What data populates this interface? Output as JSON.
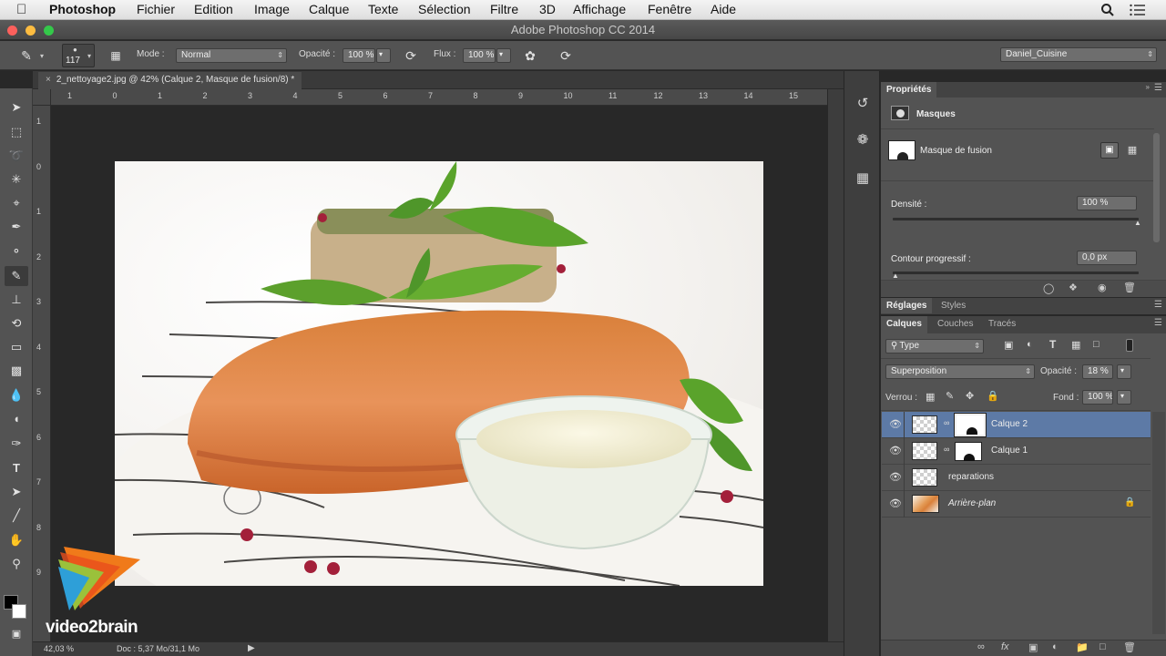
{
  "menubar": {
    "app": "Photoshop",
    "items": [
      "Fichier",
      "Edition",
      "Image",
      "Calque",
      "Texte",
      "Sélection",
      "Filtre",
      "3D",
      "Affichage",
      "Fenêtre",
      "Aide"
    ]
  },
  "window": {
    "title": "Adobe Photoshop CC 2014"
  },
  "options": {
    "brush_size": "117",
    "mode_label": "Mode :",
    "mode_value": "Normal",
    "opacity_label": "Opacité :",
    "opacity_value": "100 %",
    "flux_label": "Flux :",
    "flux_value": "100 %",
    "workspace": "Daniel_Cuisine"
  },
  "document": {
    "tab_title": "2_nettoyage2.jpg @ 42% (Calque 2, Masque de fusion/8) *",
    "ruler_h": [
      "1",
      "0",
      "1",
      "2",
      "3",
      "4",
      "5",
      "6",
      "7",
      "8",
      "9",
      "10",
      "11",
      "12",
      "13",
      "14",
      "15"
    ],
    "ruler_v": [
      "1",
      "0",
      "1",
      "2",
      "3",
      "4",
      "5",
      "6",
      "7",
      "8",
      "9"
    ]
  },
  "status": {
    "zoom": "42,03 %",
    "doc": "Doc : 5,37 Mo/31,1 Mo"
  },
  "properties": {
    "tab": "Propriétés",
    "section": "Masques",
    "mask_name": "Masque de fusion",
    "density_label": "Densité :",
    "density_value": "100 %",
    "density_level": 1.0,
    "feather_label": "Contour progressif :",
    "feather_value": "0,0 px",
    "feather_level": 0.0
  },
  "adjust_tabs": [
    "Réglages",
    "Styles"
  ],
  "layers_panel": {
    "tabs": [
      "Calques",
      "Couches",
      "Tracés"
    ],
    "filter": "Type",
    "blend_mode": "Superposition",
    "opacity_label": "Opacité :",
    "opacity_value": "18 %",
    "lock_label": "Verrou :",
    "fill_label": "Fond :",
    "fill_value": "100 %",
    "layers": [
      {
        "name": "Calque 2",
        "selected": true
      },
      {
        "name": "Calque 1",
        "selected": false
      },
      {
        "name": "reparations",
        "selected": false
      },
      {
        "name": "Arrière-plan",
        "selected": false
      }
    ]
  },
  "watermark": "video2brain"
}
